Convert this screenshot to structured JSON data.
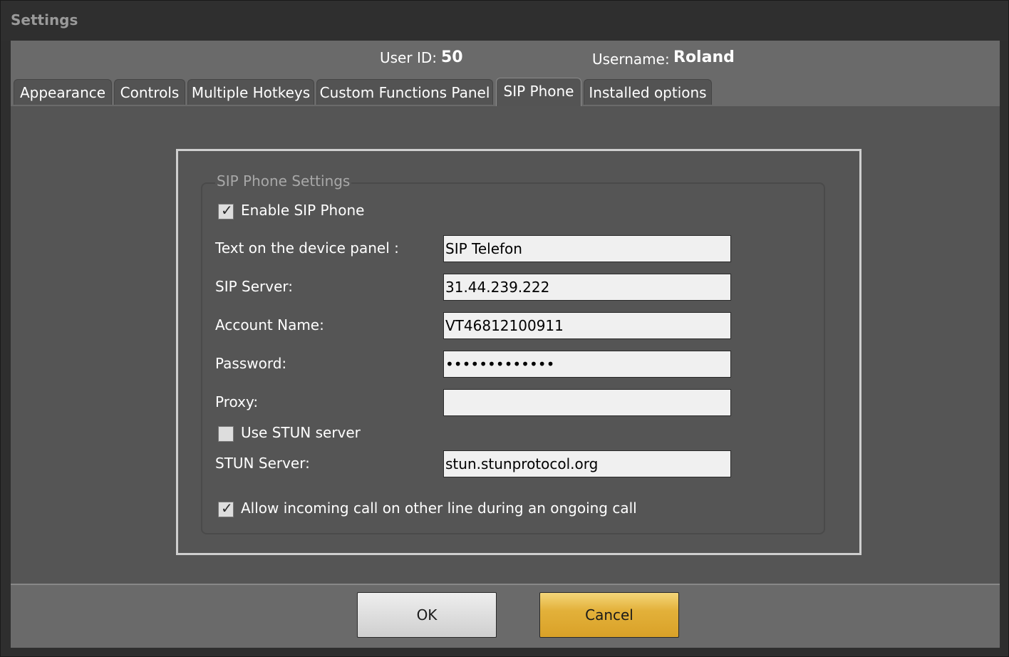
{
  "window": {
    "title": "Settings"
  },
  "header": {
    "user_id_label": "User ID:",
    "user_id_value": "50",
    "username_label": "Username:",
    "username_value": "Roland"
  },
  "tabs": [
    {
      "label": "Appearance",
      "active": false
    },
    {
      "label": "Controls",
      "active": false
    },
    {
      "label": "Multiple Hotkeys",
      "active": false
    },
    {
      "label": "Custom Functions Panel",
      "active": false
    },
    {
      "label": "SIP Phone",
      "active": true
    },
    {
      "label": "Installed options",
      "active": false
    }
  ],
  "sip": {
    "group_title": "SIP Phone Settings",
    "enable_label": "Enable SIP Phone",
    "enable_checked": true,
    "device_panel_label": "Text on the device panel :",
    "device_panel_value": "SIP Telefon",
    "server_label": "SIP Server:",
    "server_value": "31.44.239.222",
    "account_label": "Account Name:",
    "account_value": "VT46812100911",
    "password_label": "Password:",
    "password_value": "•••••••••••••",
    "proxy_label": "Proxy:",
    "proxy_value": "",
    "use_stun_label": "Use STUN server",
    "use_stun_checked": false,
    "stun_label": "STUN Server:",
    "stun_value": "stun.stunprotocol.org",
    "allow_incoming_label": "Allow incoming call on other line during an ongoing call",
    "allow_incoming_checked": true
  },
  "buttons": {
    "ok": "OK",
    "cancel": "Cancel"
  },
  "colors": {
    "cancel_accent": "#e3b13a",
    "panel_bg": "#555555"
  }
}
